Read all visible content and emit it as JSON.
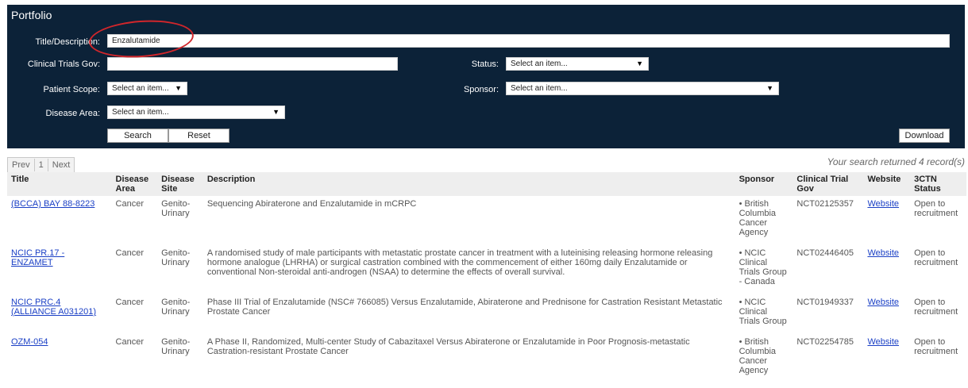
{
  "panel": {
    "title": "Portfolio"
  },
  "form": {
    "title_label": "Title/Description:",
    "title_value": "Enzalutamide",
    "ctgov_label": "Clinical Trials Gov:",
    "ctgov_value": "",
    "status_label": "Status:",
    "status_value": "Select an item...",
    "scope_label": "Patient Scope:",
    "scope_value": "Select an item...",
    "sponsor_label": "Sponsor:",
    "sponsor_value": "Select an item...",
    "disease_label": "Disease Area:",
    "disease_value": "Select an item...",
    "search_label": "Search",
    "reset_label": "Reset",
    "download_label": "Download",
    "dropdown_arrow": "▼"
  },
  "pager": {
    "prev": "Prev",
    "page": "1",
    "next": "Next"
  },
  "result_text": "Your search returned 4 record(s)",
  "table": {
    "headers": [
      "Title",
      "Disease Area",
      "Disease Site",
      "Description",
      "Sponsor",
      "Clinical Trial Gov",
      "Website",
      "3CTN Status"
    ],
    "rows": [
      {
        "title": "(BCCA) BAY 88-8223",
        "area": "Cancer",
        "site": "Genito-Urinary",
        "desc": "Sequencing Abiraterone and Enzalutamide in mCRPC",
        "sponsor": "• British Columbia Cancer Agency",
        "ctg": "NCT02125357",
        "website": "Website",
        "status": "Open to recruitment"
      },
      {
        "title": "NCIC PR.17 - ENZAMET",
        "area": "Cancer",
        "site": "Genito-Urinary",
        "desc": "A randomised study of male participants with metastatic prostate cancer in treatment with a luteinising releasing hormone releasing hormone analogue (LHRHA) or surgical castration combined with the commencement of either 160mg daily Enzalutamide or conventional Non-steroidal anti-androgen (NSAA) to determine the effects of overall survival.",
        "sponsor": "• NCIC Clinical Trials Group - Canada",
        "ctg": "NCT02446405",
        "website": "Website",
        "status": "Open to recruitment"
      },
      {
        "title": "NCIC PRC.4 (ALLIANCE A031201)",
        "area": "Cancer",
        "site": "Genito-Urinary",
        "desc": "Phase III Trial of Enzalutamide (NSC# 766085) Versus Enzalutamide, Abiraterone and Prednisone for Castration Resistant Metastatic Prostate Cancer",
        "sponsor": "• NCIC Clinical Trials Group",
        "ctg": "NCT01949337",
        "website": "Website",
        "status": "Open to recruitment"
      },
      {
        "title": "OZM-054",
        "area": "Cancer",
        "site": "Genito-Urinary",
        "desc": "A Phase II, Randomized, Multi-center Study of Cabazitaxel Versus Abiraterone or Enzalutamide in Poor Prognosis-metastatic Castration-resistant Prostate Cancer",
        "sponsor": "• British Columbia Cancer Agency",
        "ctg": "NCT02254785",
        "website": "Website",
        "status": "Open to recruitment"
      }
    ]
  },
  "colors": {
    "panel_bg": "#0c2238",
    "link": "#1a3fc5",
    "highlight_circle": "#d1262b",
    "header_bg": "#eeeeee"
  }
}
